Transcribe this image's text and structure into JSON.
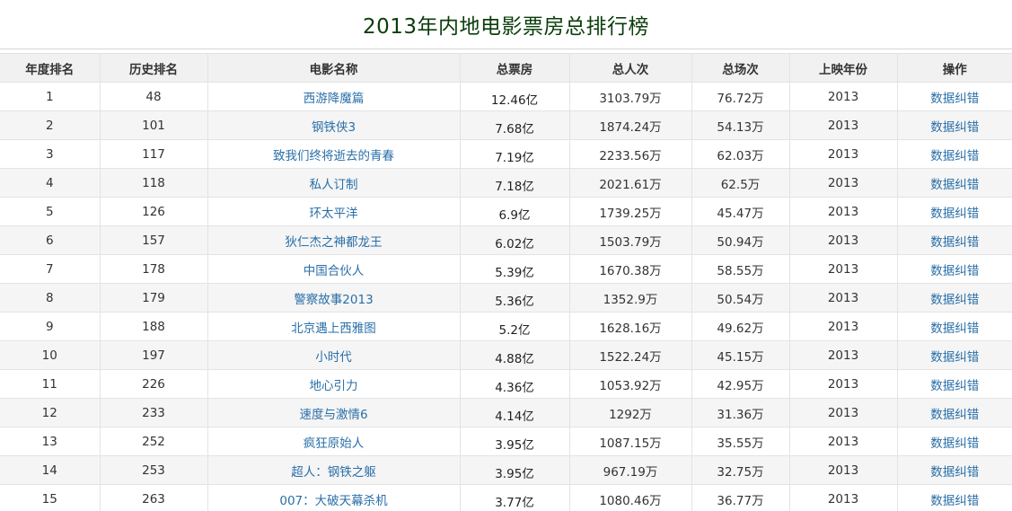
{
  "page": {
    "title": "2013年内地电影票房总排行榜"
  },
  "table": {
    "headers": [
      "年度排名",
      "历史排名",
      "电影名称",
      "总票房",
      "总人次",
      "总场次",
      "上映年份",
      "操作"
    ],
    "rows": [
      {
        "year_rank": "1",
        "hist_rank": "48",
        "film": "西游降魔篇",
        "box": "12.46亿",
        "people": "3103.79万",
        "shows": "76.72万",
        "year": "2013",
        "action": "数据纠错"
      },
      {
        "year_rank": "2",
        "hist_rank": "101",
        "film": "钢铁侠3",
        "box": "7.68亿",
        "people": "1874.24万",
        "shows": "54.13万",
        "year": "2013",
        "action": "数据纠错"
      },
      {
        "year_rank": "3",
        "hist_rank": "117",
        "film": "致我们终将逝去的青春",
        "box": "7.19亿",
        "people": "2233.56万",
        "shows": "62.03万",
        "year": "2013",
        "action": "数据纠错"
      },
      {
        "year_rank": "4",
        "hist_rank": "118",
        "film": "私人订制",
        "box": "7.18亿",
        "people": "2021.61万",
        "shows": "62.5万",
        "year": "2013",
        "action": "数据纠错"
      },
      {
        "year_rank": "5",
        "hist_rank": "126",
        "film": "环太平洋",
        "box": "6.9亿",
        "people": "1739.25万",
        "shows": "45.47万",
        "year": "2013",
        "action": "数据纠错"
      },
      {
        "year_rank": "6",
        "hist_rank": "157",
        "film": "狄仁杰之神都龙王",
        "box": "6.02亿",
        "people": "1503.79万",
        "shows": "50.94万",
        "year": "2013",
        "action": "数据纠错"
      },
      {
        "year_rank": "7",
        "hist_rank": "178",
        "film": "中国合伙人",
        "box": "5.39亿",
        "people": "1670.38万",
        "shows": "58.55万",
        "year": "2013",
        "action": "数据纠错"
      },
      {
        "year_rank": "8",
        "hist_rank": "179",
        "film": "警察故事2013",
        "box": "5.36亿",
        "people": "1352.9万",
        "shows": "50.54万",
        "year": "2013",
        "action": "数据纠错"
      },
      {
        "year_rank": "9",
        "hist_rank": "188",
        "film": "北京遇上西雅图",
        "box": "5.2亿",
        "people": "1628.16万",
        "shows": "49.62万",
        "year": "2013",
        "action": "数据纠错"
      },
      {
        "year_rank": "10",
        "hist_rank": "197",
        "film": "小时代",
        "box": "4.88亿",
        "people": "1522.24万",
        "shows": "45.15万",
        "year": "2013",
        "action": "数据纠错"
      },
      {
        "year_rank": "11",
        "hist_rank": "226",
        "film": "地心引力",
        "box": "4.36亿",
        "people": "1053.92万",
        "shows": "42.95万",
        "year": "2013",
        "action": "数据纠错"
      },
      {
        "year_rank": "12",
        "hist_rank": "233",
        "film": "速度与激情6",
        "box": "4.14亿",
        "people": "1292万",
        "shows": "31.36万",
        "year": "2013",
        "action": "数据纠错"
      },
      {
        "year_rank": "13",
        "hist_rank": "252",
        "film": "疯狂原始人",
        "box": "3.95亿",
        "people": "1087.15万",
        "shows": "35.55万",
        "year": "2013",
        "action": "数据纠错"
      },
      {
        "year_rank": "14",
        "hist_rank": "253",
        "film": "超人：钢铁之躯",
        "box": "3.95亿",
        "people": "967.19万",
        "shows": "32.75万",
        "year": "2013",
        "action": "数据纠错"
      },
      {
        "year_rank": "15",
        "hist_rank": "263",
        "film": "007：大破天幕杀机",
        "box": "3.77亿",
        "people": "1080.46万",
        "shows": "36.77万",
        "year": "2013",
        "action": "数据纠错"
      }
    ]
  },
  "colors": {
    "title": "#0b3d0b",
    "link": "#2a6fa8",
    "header_bg": "#f1f1f1",
    "stripe_bg": "#f5f5f5"
  }
}
